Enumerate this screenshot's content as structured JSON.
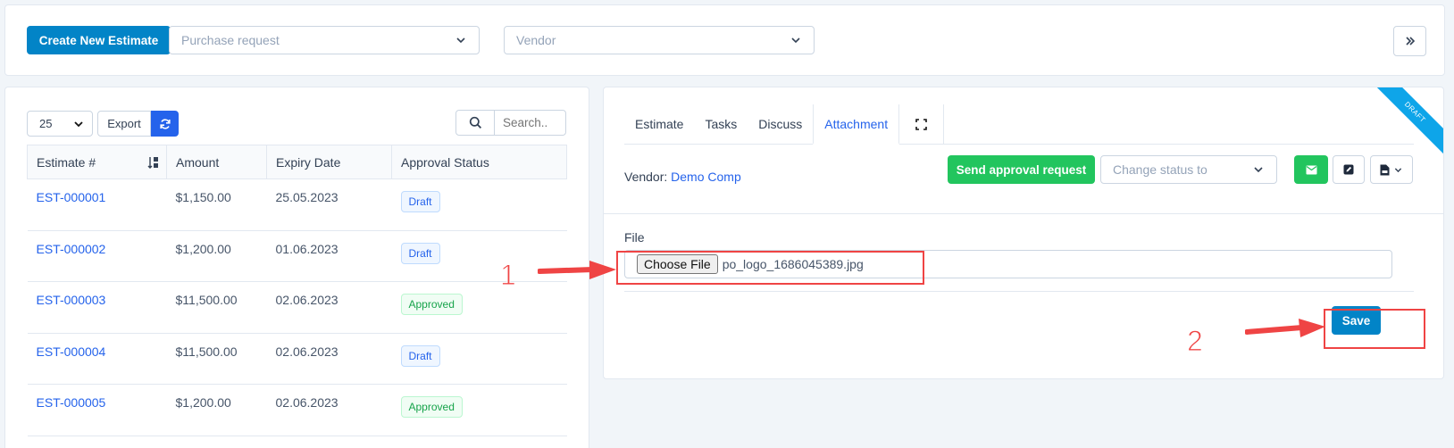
{
  "topbar": {
    "create_label": "Create New Estimate",
    "purchase_placeholder": "Purchase request",
    "vendor_placeholder": "Vendor"
  },
  "list": {
    "per_page": "25",
    "export_label": "Export",
    "search_placeholder": "Search..",
    "columns": [
      "Estimate #",
      "Amount",
      "Expiry Date",
      "Approval Status"
    ],
    "rows": [
      {
        "number": "EST-000001",
        "amount": "$1,150.00",
        "expiry": "25.05.2023",
        "status": "Draft"
      },
      {
        "number": "EST-000002",
        "amount": "$1,200.00",
        "expiry": "01.06.2023",
        "status": "Draft"
      },
      {
        "number": "EST-000003",
        "amount": "$11,500.00",
        "expiry": "02.06.2023",
        "status": "Approved"
      },
      {
        "number": "EST-000004",
        "amount": "$11,500.00",
        "expiry": "02.06.2023",
        "status": "Draft"
      },
      {
        "number": "EST-000005",
        "amount": "$1,200.00",
        "expiry": "02.06.2023",
        "status": "Approved"
      }
    ]
  },
  "detail": {
    "tabs": [
      "Estimate",
      "Tasks",
      "Discuss",
      "Attachment"
    ],
    "active_tab": "Attachment",
    "vendor_label": "Vendor:",
    "vendor_name": "Demo Comp",
    "send_label": "Send approval request",
    "status_placeholder": "Change status to",
    "ribbon": "DRAFT",
    "file_label": "File",
    "choose_label": "Choose File",
    "file_name": "po_logo_1686045389.jpg",
    "save_label": "Save"
  },
  "annotations": {
    "step1": "1",
    "step2": "2",
    "color": "#ef4444"
  },
  "colors": {
    "primary": "#0284c7",
    "success": "#22c55e",
    "link": "#2563eb"
  }
}
